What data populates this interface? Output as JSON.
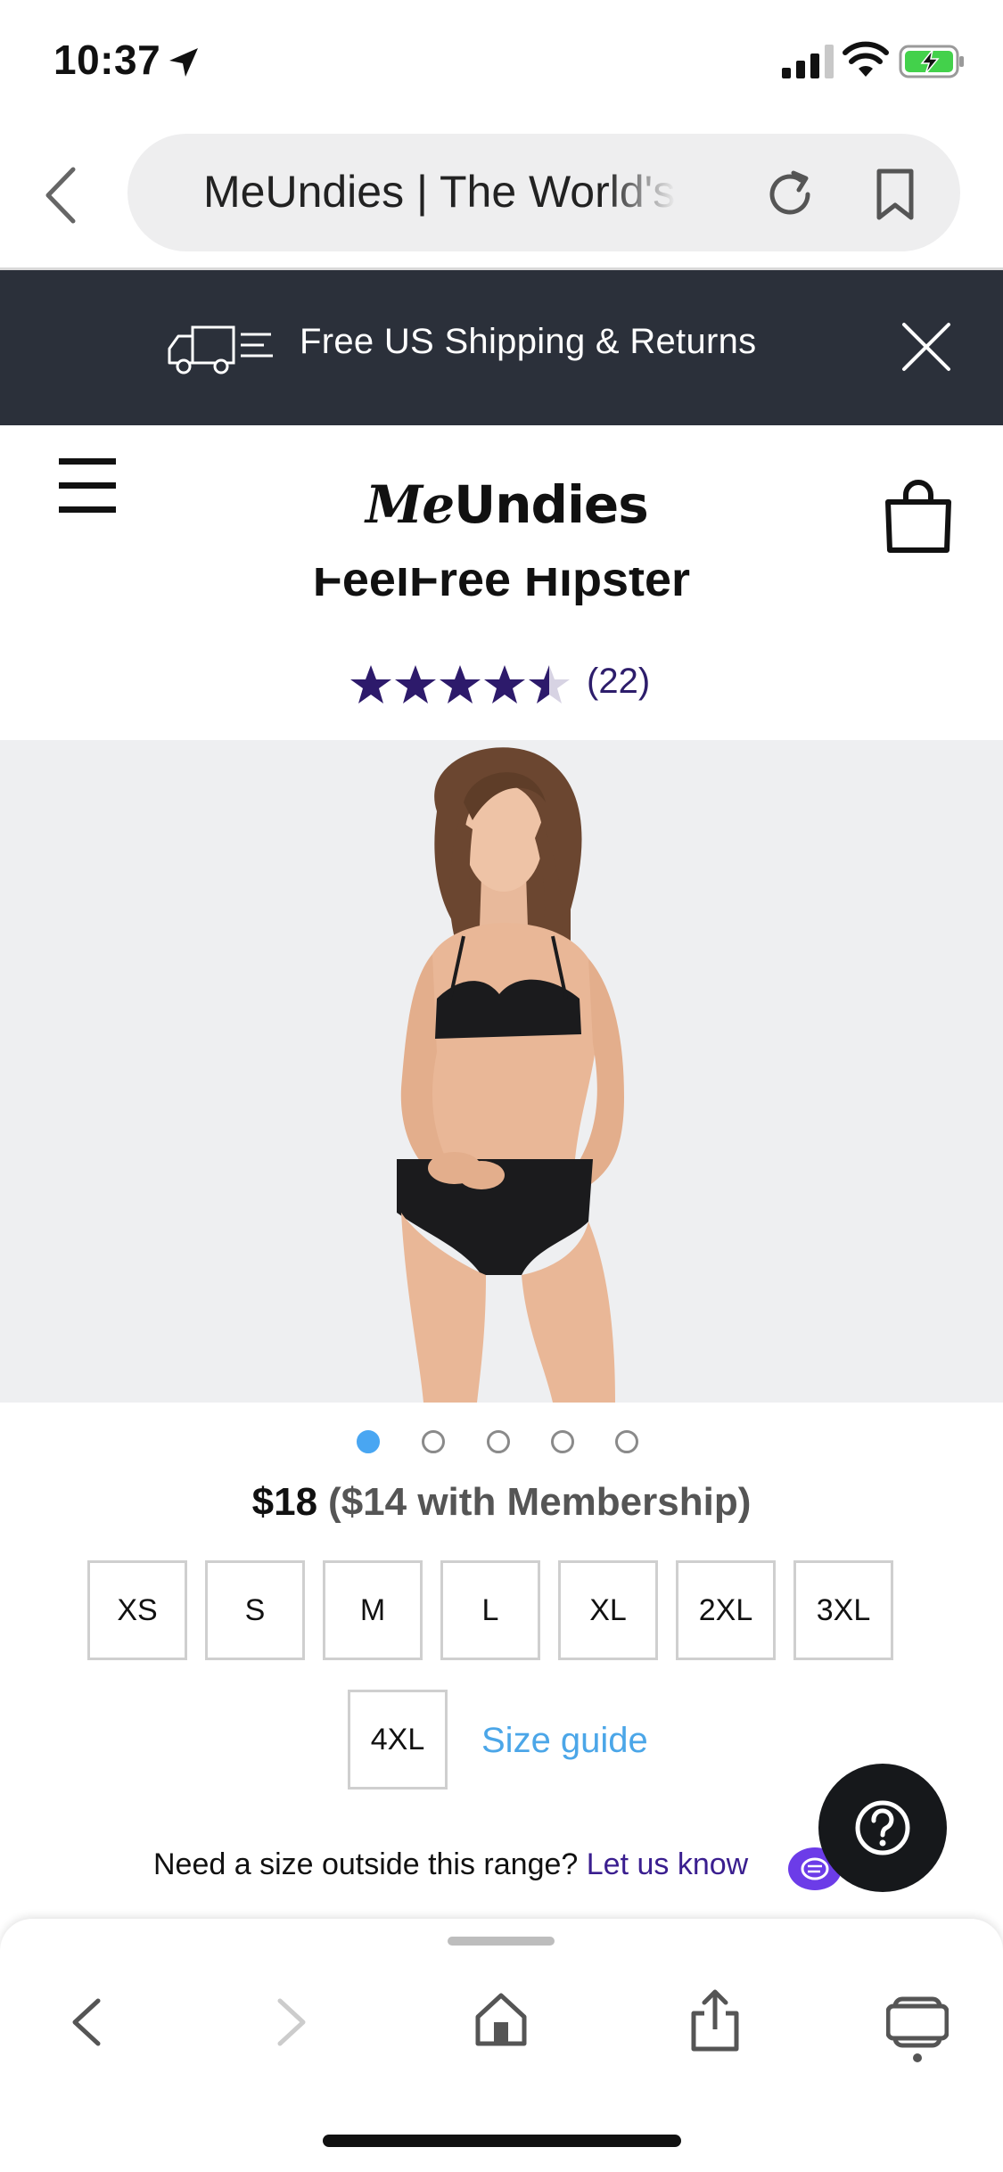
{
  "status_bar": {
    "time": "10:37"
  },
  "browser": {
    "url_title": "MeUndies | The World's",
    "icons": [
      "back-icon",
      "reload-icon",
      "bookmark-icon"
    ]
  },
  "promo": {
    "text": "Free US Shipping & Returns"
  },
  "site": {
    "logo_me": "Me",
    "logo_undies": "Undies"
  },
  "product": {
    "title": "FeelFree Hipster",
    "rating_value": 4.5,
    "rating_max": 5,
    "review_count": "(22)",
    "price": "$18",
    "member_price": "($14 with Membership)",
    "carousel_total": 5,
    "carousel_active": 1,
    "sizes": [
      "XS",
      "S",
      "M",
      "L",
      "XL",
      "2XL",
      "3XL",
      "4XL"
    ],
    "size_guide_label": "Size guide",
    "outside_range_text": "Need a size outside this range?",
    "outside_range_link": "Let us know"
  },
  "colors": {
    "promo_bg": "#2b303a",
    "star": "#2d1a6b",
    "link": "#4ba6e8",
    "dot_active": "#49a6f2"
  }
}
